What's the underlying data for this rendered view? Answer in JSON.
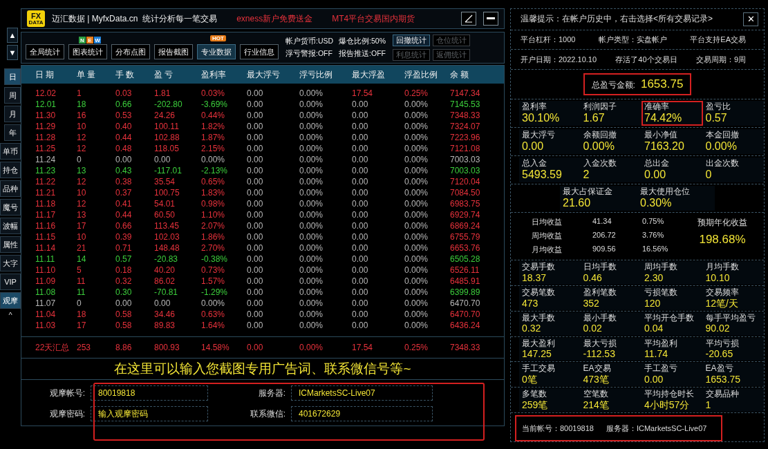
{
  "side_nav": {
    "up": "▲",
    "down": "▼",
    "items": [
      {
        "label": "日",
        "selected": true
      },
      {
        "label": "周",
        "selected": false
      },
      {
        "label": "月",
        "selected": false
      },
      {
        "label": "年",
        "selected": false
      },
      {
        "label": "单币",
        "selected": false
      },
      {
        "label": "持仓",
        "selected": false
      },
      {
        "label": "品种",
        "selected": false
      },
      {
        "label": "魔号",
        "selected": false
      },
      {
        "label": "波幅",
        "selected": false
      },
      {
        "label": "属性",
        "selected": false
      },
      {
        "label": "大字",
        "selected": false
      },
      {
        "label": "VIP",
        "selected": false
      },
      {
        "label": "观摩",
        "selected": true
      }
    ],
    "collapse": "^"
  },
  "title_bar": {
    "logo_top": "FX",
    "logo_bottom": "DATA",
    "title": "迈汇数据 | MyfxData.cn  统计分析每一笔交易",
    "ads": [
      "exness新户免费送金",
      "MT4平台交易国内期货"
    ]
  },
  "tabs": [
    {
      "label": "全局统计",
      "selected": false
    },
    {
      "label": "图表统计",
      "selected": false,
      "badge": {
        "kind": "new",
        "letters": [
          "N",
          "E",
          "W"
        ]
      }
    },
    {
      "label": "分布点图",
      "selected": false
    },
    {
      "label": "报告截图",
      "selected": false
    },
    {
      "label": "专业数据",
      "selected": true,
      "badge": {
        "kind": "hot",
        "text": "HOT"
      }
    },
    {
      "label": "行业信息",
      "selected": false
    }
  ],
  "account_info": [
    "帐户货币:USD",
    "爆仓比例:50%",
    "浮亏警报:OFF",
    "报告推送:OFF"
  ],
  "stat_buttons": [
    {
      "label": "回撤统计",
      "disabled": false
    },
    {
      "label": "仓位统计",
      "disabled": true
    },
    {
      "label": "利息统计",
      "disabled": true
    },
    {
      "label": "返佣统计",
      "disabled": true
    }
  ],
  "table": {
    "columns": [
      "日 期",
      "单 量",
      "手 数",
      "盈 亏",
      "盈利率",
      "最大浮亏",
      "浮亏比例",
      "最大浮盈",
      "浮盈比例",
      "余 额"
    ],
    "rows": [
      {
        "kind": "profit",
        "float_hit": true,
        "cells": [
          "12.02",
          "1",
          "0.03",
          "1.81",
          "0.03%",
          "0.00",
          "0.00%",
          "17.54",
          "0.25%",
          "7147.34"
        ]
      },
      {
        "kind": "loss",
        "float_hit": false,
        "cells": [
          "12.01",
          "18",
          "0.66",
          "-202.80",
          "-3.69%",
          "0.00",
          "0.00%",
          "0.00",
          "0.00%",
          "7145.53"
        ]
      },
      {
        "kind": "profit",
        "float_hit": false,
        "cells": [
          "11.30",
          "16",
          "0.53",
          "24.26",
          "0.44%",
          "0.00",
          "0.00%",
          "0.00",
          "0.00%",
          "7348.33"
        ]
      },
      {
        "kind": "profit",
        "float_hit": false,
        "cells": [
          "11.29",
          "10",
          "0.40",
          "100.11",
          "1.82%",
          "0.00",
          "0.00%",
          "0.00",
          "0.00%",
          "7324.07"
        ]
      },
      {
        "kind": "profit",
        "float_hit": false,
        "cells": [
          "11.28",
          "12",
          "0.44",
          "102.88",
          "1.87%",
          "0.00",
          "0.00%",
          "0.00",
          "0.00%",
          "7223.96"
        ]
      },
      {
        "kind": "profit",
        "float_hit": false,
        "cells": [
          "11.25",
          "12",
          "0.48",
          "118.05",
          "2.15%",
          "0.00",
          "0.00%",
          "0.00",
          "0.00%",
          "7121.08"
        ]
      },
      {
        "kind": "flat",
        "float_hit": false,
        "cells": [
          "11.24",
          "0",
          "0.00",
          "0.00",
          "0.00%",
          "0.00",
          "0.00%",
          "0.00",
          "0.00%",
          "7003.03"
        ]
      },
      {
        "kind": "loss",
        "float_hit": false,
        "cells": [
          "11.23",
          "13",
          "0.43",
          "-117.01",
          "-2.13%",
          "0.00",
          "0.00%",
          "0.00",
          "0.00%",
          "7003.03"
        ]
      },
      {
        "kind": "profit",
        "float_hit": false,
        "cells": [
          "11.22",
          "12",
          "0.38",
          "35.54",
          "0.65%",
          "0.00",
          "0.00%",
          "0.00",
          "0.00%",
          "7120.04"
        ]
      },
      {
        "kind": "profit",
        "float_hit": false,
        "cells": [
          "11.21",
          "10",
          "0.37",
          "100.75",
          "1.83%",
          "0.00",
          "0.00%",
          "0.00",
          "0.00%",
          "7084.50"
        ]
      },
      {
        "kind": "profit",
        "float_hit": false,
        "cells": [
          "11.18",
          "12",
          "0.41",
          "54.01",
          "0.98%",
          "0.00",
          "0.00%",
          "0.00",
          "0.00%",
          "6983.75"
        ]
      },
      {
        "kind": "profit",
        "float_hit": false,
        "cells": [
          "11.17",
          "13",
          "0.44",
          "60.50",
          "1.10%",
          "0.00",
          "0.00%",
          "0.00",
          "0.00%",
          "6929.74"
        ]
      },
      {
        "kind": "profit",
        "float_hit": false,
        "cells": [
          "11.16",
          "17",
          "0.66",
          "113.45",
          "2.07%",
          "0.00",
          "0.00%",
          "0.00",
          "0.00%",
          "6869.24"
        ]
      },
      {
        "kind": "profit",
        "float_hit": false,
        "cells": [
          "11.15",
          "10",
          "0.39",
          "102.03",
          "1.86%",
          "0.00",
          "0.00%",
          "0.00",
          "0.00%",
          "6755.79"
        ]
      },
      {
        "kind": "profit",
        "float_hit": false,
        "cells": [
          "11.14",
          "21",
          "0.71",
          "148.48",
          "2.70%",
          "0.00",
          "0.00%",
          "0.00",
          "0.00%",
          "6653.76"
        ]
      },
      {
        "kind": "loss",
        "float_hit": false,
        "cells": [
          "11.11",
          "14",
          "0.57",
          "-20.83",
          "-0.38%",
          "0.00",
          "0.00%",
          "0.00",
          "0.00%",
          "6505.28"
        ]
      },
      {
        "kind": "profit",
        "float_hit": false,
        "cells": [
          "11.10",
          "5",
          "0.18",
          "40.20",
          "0.73%",
          "0.00",
          "0.00%",
          "0.00",
          "0.00%",
          "6526.11"
        ]
      },
      {
        "kind": "profit",
        "float_hit": false,
        "cells": [
          "11.09",
          "11",
          "0.32",
          "86.02",
          "1.57%",
          "0.00",
          "0.00%",
          "0.00",
          "0.00%",
          "6485.91"
        ]
      },
      {
        "kind": "loss",
        "float_hit": false,
        "cells": [
          "11.08",
          "11",
          "0.30",
          "-70.81",
          "-1.29%",
          "0.00",
          "0.00%",
          "0.00",
          "0.00%",
          "6399.89"
        ]
      },
      {
        "kind": "flat",
        "float_hit": false,
        "cells": [
          "11.07",
          "0",
          "0.00",
          "0.00",
          "0.00%",
          "0.00",
          "0.00%",
          "0.00",
          "0.00%",
          "6470.70"
        ]
      },
      {
        "kind": "profit",
        "float_hit": false,
        "cells": [
          "11.04",
          "18",
          "0.58",
          "34.46",
          "0.63%",
          "0.00",
          "0.00%",
          "0.00",
          "0.00%",
          "6470.70"
        ]
      },
      {
        "kind": "profit",
        "float_hit": false,
        "cells": [
          "11.03",
          "17",
          "0.58",
          "89.83",
          "1.64%",
          "0.00",
          "0.00%",
          "0.00",
          "0.00%",
          "6436.24"
        ]
      }
    ],
    "total": [
      "22天汇总",
      "253",
      "8.86",
      "800.93",
      "14.58%",
      "0.00",
      "0.00%",
      "17.54",
      "0.25%",
      "7348.33"
    ]
  },
  "banner": "在这里可以输入您截图专用广告词、联系微信号等~",
  "watch_form": {
    "highlighted": true,
    "fields": [
      {
        "label": "观摩帐号:",
        "value": "80019818"
      },
      {
        "label": "服务器:",
        "value": "ICMarketsSC-Live07"
      },
      {
        "label": "观摩密码:",
        "placeholder": "输入观摩密码"
      },
      {
        "label": "联系微信:",
        "value": "401672629"
      }
    ]
  },
  "right_panel": {
    "tip": "温馨提示：在帐户历史中，右击选择<所有交易记录>",
    "close": "✕",
    "info_rows": [
      [
        "平台杠杆：1000",
        "帐户类型：实盘帐户",
        "平台支持EA交易"
      ],
      [
        "开户日期：2022.10.10",
        "存活了40个交易日",
        "交易周期：9周"
      ]
    ],
    "total": {
      "label": "总盈亏金额:",
      "value": "1653.75",
      "highlighted": true
    },
    "stat_rows": [
      [
        {
          "label": "盈利率",
          "value": "30.10%",
          "highlighted": false
        },
        {
          "label": "利润因子",
          "value": "1.67",
          "highlighted": false
        },
        {
          "label": "准确率",
          "value": "74.42%",
          "highlighted": true
        },
        {
          "label": "盈亏比",
          "value": "0.57",
          "highlighted": false
        }
      ],
      [
        {
          "label": "最大浮亏",
          "value": "0.00",
          "highlighted": false
        },
        {
          "label": "余额回撤",
          "value": "0.00%",
          "highlighted": false
        },
        {
          "label": "最小净值",
          "value": "7163.20",
          "highlighted": false
        },
        {
          "label": "本金回撤",
          "value": "0.00%",
          "highlighted": false
        }
      ],
      [
        {
          "label": "总入金",
          "value": "5493.59",
          "highlighted": false
        },
        {
          "label": "入金次数",
          "value": "2",
          "highlighted": false
        },
        {
          "label": "总出金",
          "value": "0.00",
          "highlighted": false
        },
        {
          "label": "出金次数",
          "value": "0",
          "highlighted": false
        }
      ]
    ],
    "margin_row": [
      {
        "label": "最大占保证金",
        "value": "21.60"
      },
      {
        "label": "最大使用仓位",
        "value": "0.30%"
      }
    ],
    "returns": {
      "rows": [
        [
          "日均收益",
          "41.34",
          "0.75%"
        ],
        [
          "周均收益",
          "206.72",
          "3.76%"
        ],
        [
          "月均收益",
          "909.56",
          "16.56%"
        ]
      ],
      "annual_label": "预期年化收益",
      "annual_value": "198.68%"
    },
    "stat_rows_2": [
      [
        {
          "label": "交易手数",
          "value": "18.37"
        },
        {
          "label": "日均手数",
          "value": "0.46"
        },
        {
          "label": "周均手数",
          "value": "2.30"
        },
        {
          "label": "月均手数",
          "value": "10.10"
        }
      ],
      [
        {
          "label": "交易笔数",
          "value": "473"
        },
        {
          "label": "盈利笔数",
          "value": "352"
        },
        {
          "label": "亏损笔数",
          "value": "120"
        },
        {
          "label": "交易频率",
          "value": "12笔/天"
        }
      ],
      [
        {
          "label": "最大手数",
          "value": "0.32"
        },
        {
          "label": "最小手数",
          "value": "0.02"
        },
        {
          "label": "平均开仓手数",
          "value": "0.04"
        },
        {
          "label": "每手平均盈亏",
          "value": "90.02"
        }
      ],
      [
        {
          "label": "最大盈利",
          "value": "147.25"
        },
        {
          "label": "最大亏损",
          "value": "-112.53"
        },
        {
          "label": "平均盈利",
          "value": "11.74"
        },
        {
          "label": "平均亏损",
          "value": "-20.65"
        }
      ],
      [
        {
          "label": "手工交易",
          "value": "0笔"
        },
        {
          "label": "EA交易",
          "value": "473笔"
        },
        {
          "label": "手工盈亏",
          "value": "0.00"
        },
        {
          "label": "EA盈亏",
          "value": "1653.75"
        }
      ],
      [
        {
          "label": "多笔数",
          "value": "259笔"
        },
        {
          "label": "空笔数",
          "value": "214笔"
        },
        {
          "label": "平均持仓时长",
          "value": "4小时57分"
        },
        {
          "label": "交易品种",
          "value": "1"
        }
      ]
    ],
    "footer": {
      "account": "当前帐号：80019818",
      "server": "服务器：ICMarketsSC-Live07",
      "highlighted": true
    }
  }
}
